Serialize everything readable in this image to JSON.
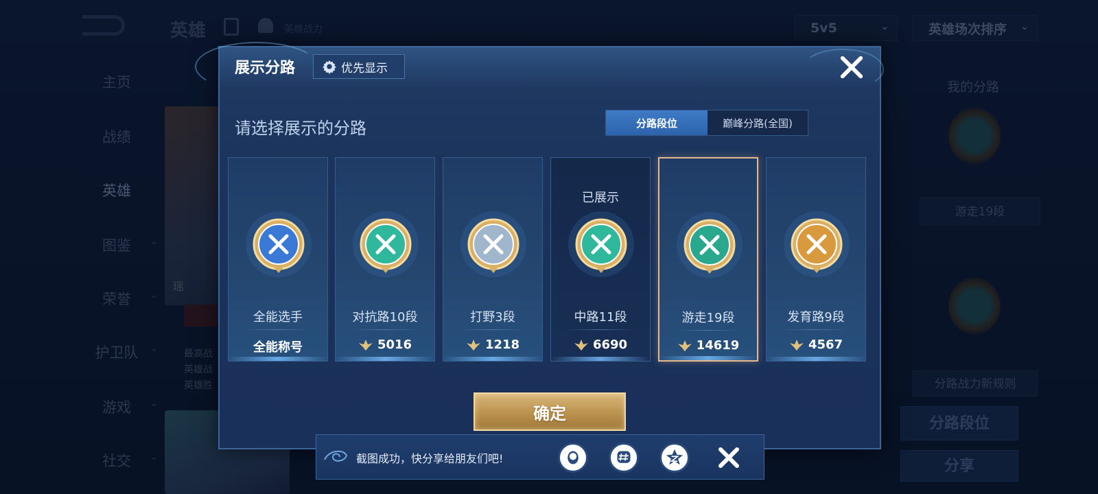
{
  "background": {
    "title": "英雄",
    "power_label": "英雄战力",
    "mode_select": "5v5",
    "sort_select": "英雄场次排序",
    "nav": [
      {
        "label": "主页",
        "has_arrow": false
      },
      {
        "label": "战绩",
        "has_arrow": false
      },
      {
        "label": "英雄",
        "has_arrow": false
      },
      {
        "label": "图鉴",
        "has_arrow": true
      },
      {
        "label": "荣誉",
        "has_arrow": true
      },
      {
        "label": "护卫队",
        "has_arrow": true
      },
      {
        "label": "游戏",
        "has_arrow": true
      },
      {
        "label": "社交",
        "has_arrow": true
      }
    ],
    "hero_name": "瑶",
    "hero_card_texts": [
      "最高战",
      "英雄战",
      "英雄胜"
    ],
    "right_title": "我的分路",
    "right_lane": "游走19段",
    "right_rule": "分路战力新规则",
    "right_btn1": "分路段位",
    "right_btn2": "分享"
  },
  "modal": {
    "title": "展示分路",
    "priority_button": "优先显示",
    "subtitle": "请选择展示的分路",
    "tabs": [
      {
        "label": "分路段位",
        "active": true
      },
      {
        "label": "巅峰分路(全国)",
        "active": false
      }
    ],
    "shown_label": "已展示",
    "cards": [
      {
        "label": "全能选手",
        "value": "全能称号",
        "emblem": "all-round-emblem",
        "color": "#3a7ad6",
        "show_power_icon": false,
        "shown": false,
        "selected": false
      },
      {
        "label": "对抗路10段",
        "value": "5016",
        "emblem": "clash-lane-emblem",
        "color": "#2fb89c",
        "show_power_icon": true,
        "shown": false,
        "selected": false
      },
      {
        "label": "打野3段",
        "value": "1218",
        "emblem": "jungle-emblem",
        "color": "#9fb6cc",
        "show_power_icon": true,
        "shown": false,
        "selected": false
      },
      {
        "label": "中路11段",
        "value": "6690",
        "emblem": "mid-lane-emblem",
        "color": "#2fb89c",
        "show_power_icon": true,
        "shown": true,
        "selected": false
      },
      {
        "label": "游走19段",
        "value": "14619",
        "emblem": "roam-emblem",
        "color": "#2aa88e",
        "show_power_icon": true,
        "shown": false,
        "selected": true
      },
      {
        "label": "发育路9段",
        "value": "4567",
        "emblem": "farm-lane-emblem",
        "color": "#d89a3c",
        "show_power_icon": true,
        "shown": false,
        "selected": false
      }
    ],
    "confirm_button": "确定"
  },
  "toast": {
    "message": "截图成功，快分享给朋友们吧!",
    "share_targets": [
      "qq-icon",
      "wechat-moments-icon",
      "qzone-icon"
    ]
  }
}
